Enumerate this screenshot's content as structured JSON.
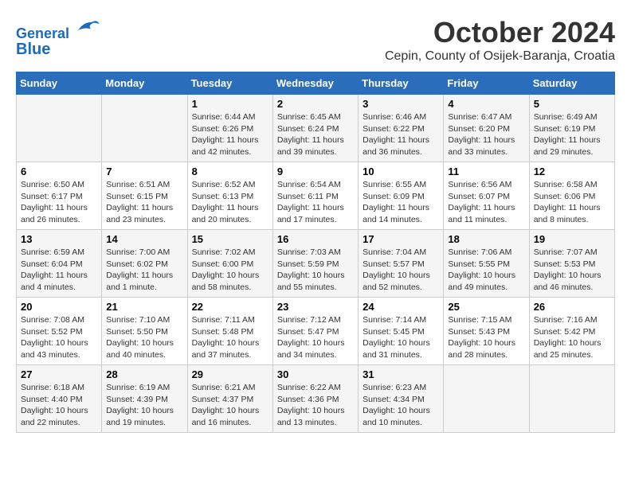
{
  "header": {
    "logo_line1": "General",
    "logo_line2": "Blue",
    "month": "October 2024",
    "location": "Cepin, County of Osijek-Baranja, Croatia"
  },
  "days_of_week": [
    "Sunday",
    "Monday",
    "Tuesday",
    "Wednesday",
    "Thursday",
    "Friday",
    "Saturday"
  ],
  "weeks": [
    [
      {
        "day": "",
        "info": ""
      },
      {
        "day": "",
        "info": ""
      },
      {
        "day": "1",
        "info": "Sunrise: 6:44 AM\nSunset: 6:26 PM\nDaylight: 11 hours and 42 minutes."
      },
      {
        "day": "2",
        "info": "Sunrise: 6:45 AM\nSunset: 6:24 PM\nDaylight: 11 hours and 39 minutes."
      },
      {
        "day": "3",
        "info": "Sunrise: 6:46 AM\nSunset: 6:22 PM\nDaylight: 11 hours and 36 minutes."
      },
      {
        "day": "4",
        "info": "Sunrise: 6:47 AM\nSunset: 6:20 PM\nDaylight: 11 hours and 33 minutes."
      },
      {
        "day": "5",
        "info": "Sunrise: 6:49 AM\nSunset: 6:19 PM\nDaylight: 11 hours and 29 minutes."
      }
    ],
    [
      {
        "day": "6",
        "info": "Sunrise: 6:50 AM\nSunset: 6:17 PM\nDaylight: 11 hours and 26 minutes."
      },
      {
        "day": "7",
        "info": "Sunrise: 6:51 AM\nSunset: 6:15 PM\nDaylight: 11 hours and 23 minutes."
      },
      {
        "day": "8",
        "info": "Sunrise: 6:52 AM\nSunset: 6:13 PM\nDaylight: 11 hours and 20 minutes."
      },
      {
        "day": "9",
        "info": "Sunrise: 6:54 AM\nSunset: 6:11 PM\nDaylight: 11 hours and 17 minutes."
      },
      {
        "day": "10",
        "info": "Sunrise: 6:55 AM\nSunset: 6:09 PM\nDaylight: 11 hours and 14 minutes."
      },
      {
        "day": "11",
        "info": "Sunrise: 6:56 AM\nSunset: 6:07 PM\nDaylight: 11 hours and 11 minutes."
      },
      {
        "day": "12",
        "info": "Sunrise: 6:58 AM\nSunset: 6:06 PM\nDaylight: 11 hours and 8 minutes."
      }
    ],
    [
      {
        "day": "13",
        "info": "Sunrise: 6:59 AM\nSunset: 6:04 PM\nDaylight: 11 hours and 4 minutes."
      },
      {
        "day": "14",
        "info": "Sunrise: 7:00 AM\nSunset: 6:02 PM\nDaylight: 11 hours and 1 minute."
      },
      {
        "day": "15",
        "info": "Sunrise: 7:02 AM\nSunset: 6:00 PM\nDaylight: 10 hours and 58 minutes."
      },
      {
        "day": "16",
        "info": "Sunrise: 7:03 AM\nSunset: 5:59 PM\nDaylight: 10 hours and 55 minutes."
      },
      {
        "day": "17",
        "info": "Sunrise: 7:04 AM\nSunset: 5:57 PM\nDaylight: 10 hours and 52 minutes."
      },
      {
        "day": "18",
        "info": "Sunrise: 7:06 AM\nSunset: 5:55 PM\nDaylight: 10 hours and 49 minutes."
      },
      {
        "day": "19",
        "info": "Sunrise: 7:07 AM\nSunset: 5:53 PM\nDaylight: 10 hours and 46 minutes."
      }
    ],
    [
      {
        "day": "20",
        "info": "Sunrise: 7:08 AM\nSunset: 5:52 PM\nDaylight: 10 hours and 43 minutes."
      },
      {
        "day": "21",
        "info": "Sunrise: 7:10 AM\nSunset: 5:50 PM\nDaylight: 10 hours and 40 minutes."
      },
      {
        "day": "22",
        "info": "Sunrise: 7:11 AM\nSunset: 5:48 PM\nDaylight: 10 hours and 37 minutes."
      },
      {
        "day": "23",
        "info": "Sunrise: 7:12 AM\nSunset: 5:47 PM\nDaylight: 10 hours and 34 minutes."
      },
      {
        "day": "24",
        "info": "Sunrise: 7:14 AM\nSunset: 5:45 PM\nDaylight: 10 hours and 31 minutes."
      },
      {
        "day": "25",
        "info": "Sunrise: 7:15 AM\nSunset: 5:43 PM\nDaylight: 10 hours and 28 minutes."
      },
      {
        "day": "26",
        "info": "Sunrise: 7:16 AM\nSunset: 5:42 PM\nDaylight: 10 hours and 25 minutes."
      }
    ],
    [
      {
        "day": "27",
        "info": "Sunrise: 6:18 AM\nSunset: 4:40 PM\nDaylight: 10 hours and 22 minutes."
      },
      {
        "day": "28",
        "info": "Sunrise: 6:19 AM\nSunset: 4:39 PM\nDaylight: 10 hours and 19 minutes."
      },
      {
        "day": "29",
        "info": "Sunrise: 6:21 AM\nSunset: 4:37 PM\nDaylight: 10 hours and 16 minutes."
      },
      {
        "day": "30",
        "info": "Sunrise: 6:22 AM\nSunset: 4:36 PM\nDaylight: 10 hours and 13 minutes."
      },
      {
        "day": "31",
        "info": "Sunrise: 6:23 AM\nSunset: 4:34 PM\nDaylight: 10 hours and 10 minutes."
      },
      {
        "day": "",
        "info": ""
      },
      {
        "day": "",
        "info": ""
      }
    ]
  ]
}
